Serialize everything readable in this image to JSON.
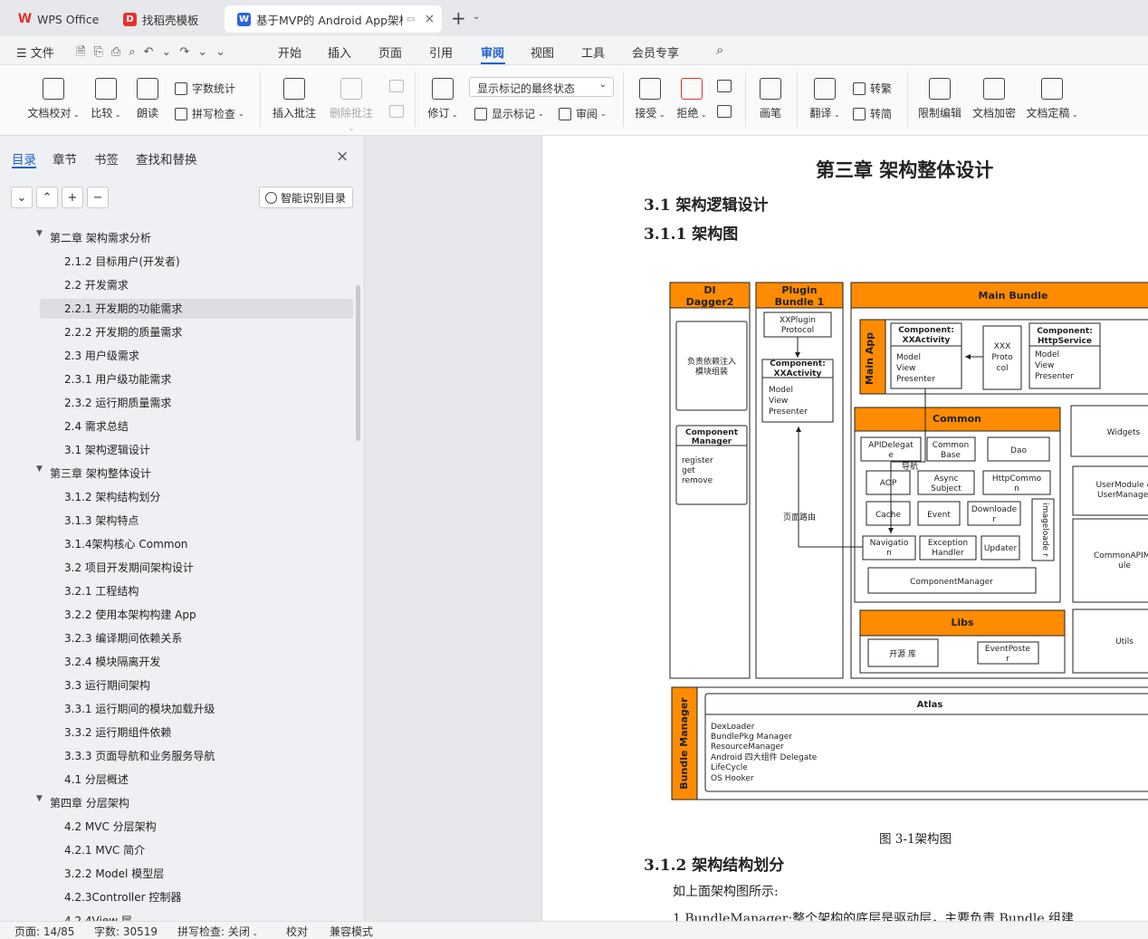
{
  "tabs": [
    {
      "label": "WPS Office"
    },
    {
      "label": "找稻壳模板"
    },
    {
      "label": "基于MVP的 Android App架构"
    }
  ],
  "menu": {
    "file": "文件",
    "items": [
      "开始",
      "插入",
      "页面",
      "引用",
      "审阅",
      "视图",
      "工具",
      "会员专享"
    ],
    "active": "审阅"
  },
  "ribbon": {
    "doc_proofread": "文档校对",
    "compare": "比较",
    "read_aloud": "朗读",
    "word_count": "字数统计",
    "spell_check": "拼写检查",
    "insert_comment": "插入批注",
    "delete_comment": "删除批注",
    "revise": "修订",
    "markup_state": "显示标记的最终状态",
    "show_markup": "显示标记",
    "review": "审阅",
    "accept": "接受",
    "reject": "拒绝",
    "pen": "画笔",
    "translate": "翻译",
    "to_traditional": "转繁",
    "to_simplified": "转简",
    "restrict_edit": "限制编辑",
    "encrypt": "文档加密",
    "finalize": "文档定稿"
  },
  "sidepanel": {
    "tabs": [
      "目录",
      "章节",
      "书签",
      "查找和替换"
    ],
    "smart_toc": "智能识别目录",
    "toc": [
      {
        "text": "第二章 架构需求分析",
        "level": 1,
        "expanded": true
      },
      {
        "text": "2.1.2 目标用户(开发者)",
        "level": 2
      },
      {
        "text": "2.2 开发需求",
        "level": 2
      },
      {
        "text": "2.2.1 开发期的功能需求",
        "level": 2,
        "selected": true
      },
      {
        "text": "2.2.2 开发期的质量需求",
        "level": 2
      },
      {
        "text": "2.3 用户级需求",
        "level": 2
      },
      {
        "text": "2.3.1 用户级功能需求",
        "level": 2
      },
      {
        "text": "2.3.2 运行期质量需求",
        "level": 2
      },
      {
        "text": "2.4 需求总结",
        "level": 2
      },
      {
        "text": "3.1 架构逻辑设计",
        "level": 2
      },
      {
        "text": "第三章 架构整体设计",
        "level": 1,
        "expanded": true
      },
      {
        "text": "3.1.2 架构结构划分",
        "level": 2
      },
      {
        "text": "3.1.3 架构特点",
        "level": 2
      },
      {
        "text": "3.1.4架构核心 Common",
        "level": 2
      },
      {
        "text": "3.2 项目开发期间架构设计",
        "level": 2
      },
      {
        "text": "3.2.1 工程结构",
        "level": 2
      },
      {
        "text": "3.2.2  使用本架构构建 App",
        "level": 2
      },
      {
        "text": "3.2.3 编译期间依赖关系",
        "level": 2
      },
      {
        "text": "3.2.4 模块隔离开发",
        "level": 2
      },
      {
        "text": "3.3 运行期间架构",
        "level": 2
      },
      {
        "text": "3.3.1 运行期间的模块加载升级",
        "level": 2
      },
      {
        "text": "3.3.2 运行期组件依赖",
        "level": 2
      },
      {
        "text": "3.3.3 页面导航和业务服务导航",
        "level": 2
      },
      {
        "text": "4.1 分层概述",
        "level": 2
      },
      {
        "text": "第四章 分层架构",
        "level": 1,
        "expanded": true
      },
      {
        "text": "4.2 MVC 分层架构",
        "level": 2
      },
      {
        "text": "4.2.1 MVC 简介",
        "level": 2
      },
      {
        "text": "3.2.2 Model 模型层",
        "level": 2
      },
      {
        "text": "4.2.3Controller 控制器",
        "level": 2
      },
      {
        "text": "4.2.4View 层",
        "level": 2
      }
    ]
  },
  "document": {
    "chapter_title": "第三章  架构整体设计",
    "h2": "3.1  架构逻辑设计",
    "h3": "3.1.1  架构图",
    "figure_caption": "图  3-1架构图",
    "h3b": "3.1.2  架构结构划分",
    "para1": "如上面架构图所示:",
    "para2": "1.BundleManager:整个架构的底层是驱动层，主要负责  Bundle 组建",
    "diagram": {
      "di_title1": "DI",
      "di_title2": "Dagger2",
      "di_box": [
        "负责依赖注入",
        "模块组装"
      ],
      "component_manager_title": [
        "Component",
        "Manager"
      ],
      "component_manager_items": [
        "register",
        "get",
        "remove"
      ],
      "plugin_title1": "Plugin",
      "plugin_title2": "Bundle 1",
      "plugin_protocol": [
        "XXPlugin",
        "Protocol"
      ],
      "plugin_component": [
        "Component:",
        "XXActivity"
      ],
      "plugin_mvp": [
        "Model",
        "View",
        "Presenter"
      ],
      "page_route": "页面路由",
      "main_bundle": "Main Bundle",
      "main_app": "Main App",
      "main_component": [
        "Component:",
        "XXActivity"
      ],
      "main_mvp": [
        "Model",
        "View",
        "Presenter"
      ],
      "xxx_protocol": [
        "XXX",
        "Proto",
        "col"
      ],
      "http_component": [
        "Component:",
        "HttpService"
      ],
      "http_mvp": [
        "Model",
        "View",
        "Presenter"
      ],
      "common": "Common",
      "common_cells": [
        [
          "APIDelegat",
          "e"
        ],
        [
          "Common",
          "Base"
        ],
        [
          "Dao"
        ],
        [
          "AOP"
        ],
        [
          "Async",
          "Subject"
        ],
        [
          "HttpCommo",
          "n"
        ],
        [
          "Cache"
        ],
        [
          "Event"
        ],
        [
          "Downloade",
          "r"
        ],
        [
          "Navigatio",
          "n"
        ],
        [
          "Exception",
          "Handler"
        ],
        [
          "Updater"
        ]
      ],
      "image_loader": "imageloade r",
      "nav_label": "导航",
      "component_manager2": "ComponentManager",
      "widgets": "Widgets",
      "user_module": [
        "UserModule &",
        "UserManager"
      ],
      "common_api": [
        "CommonAPIMo",
        "ule"
      ],
      "utils": "Utils",
      "libs": "Libs",
      "open_source": "开源 库",
      "event_poster": [
        "EventPoste",
        "r"
      ],
      "bundle_manager": "Bundle Manager",
      "atlas": "Atlas",
      "atlas_items": [
        "DexLoader",
        "BundlePkg Manager",
        "ResourceManager",
        "Android 四大组件 Delegate",
        "LifeCycle",
        "OS Hooker"
      ]
    }
  },
  "status": {
    "page": "页面: 14/85",
    "words": "字数: 30519",
    "spell": "拼写检查: 关闭",
    "proof": "校对",
    "compat": "兼容模式"
  },
  "colors": {
    "accent": "#1f5fcf",
    "diagram_orange": "#ff8c00",
    "wps_red": "#e8312d"
  }
}
